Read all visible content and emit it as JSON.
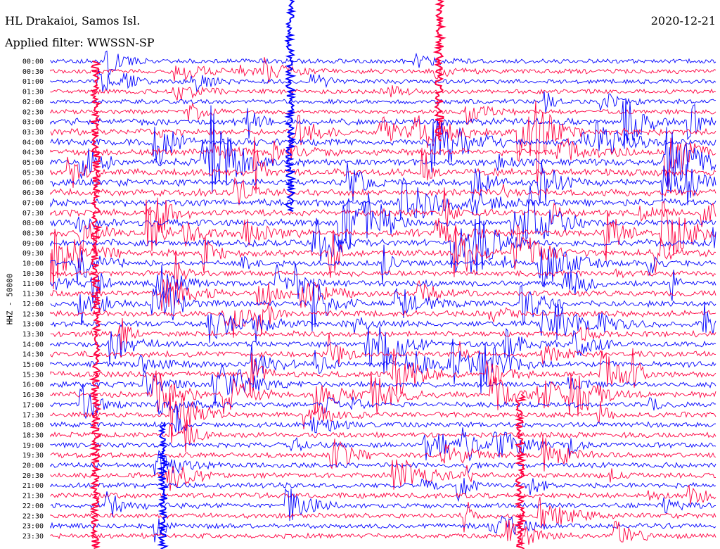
{
  "header": {
    "station": "HL Drakaioi, Samos Isl.",
    "filter": "Applied filter: WWSSN-SP",
    "date": "2020-12-21"
  },
  "chart_data": {
    "type": "line",
    "title": "HL Drakaioi, Samos Isl.",
    "subtitle": "Applied filter: WWSSN-SP",
    "date": "2020-12-21",
    "ylabel": "HHZ - 50000",
    "ytick_labels": [
      "00:00",
      "00:30",
      "01:00",
      "01:30",
      "02:00",
      "02:30",
      "03:00",
      "03:30",
      "04:00",
      "04:30",
      "05:00",
      "05:30",
      "06:00",
      "06:30",
      "07:00",
      "07:30",
      "08:00",
      "08:30",
      "09:00",
      "09:30",
      "10:00",
      "10:30",
      "11:00",
      "11:30",
      "12:00",
      "12:30",
      "13:00",
      "13:30",
      "14:00",
      "14:30",
      "15:00",
      "15:30",
      "16:00",
      "16:30",
      "17:00",
      "17:30",
      "18:00",
      "18:30",
      "19:00",
      "19:30",
      "20:00",
      "20:30",
      "21:00",
      "21:30",
      "22:00",
      "22:30",
      "23:00",
      "23:30"
    ],
    "series_colors": [
      "#0000ff",
      "#ff0040"
    ],
    "grid": false,
    "legend": "none"
  }
}
